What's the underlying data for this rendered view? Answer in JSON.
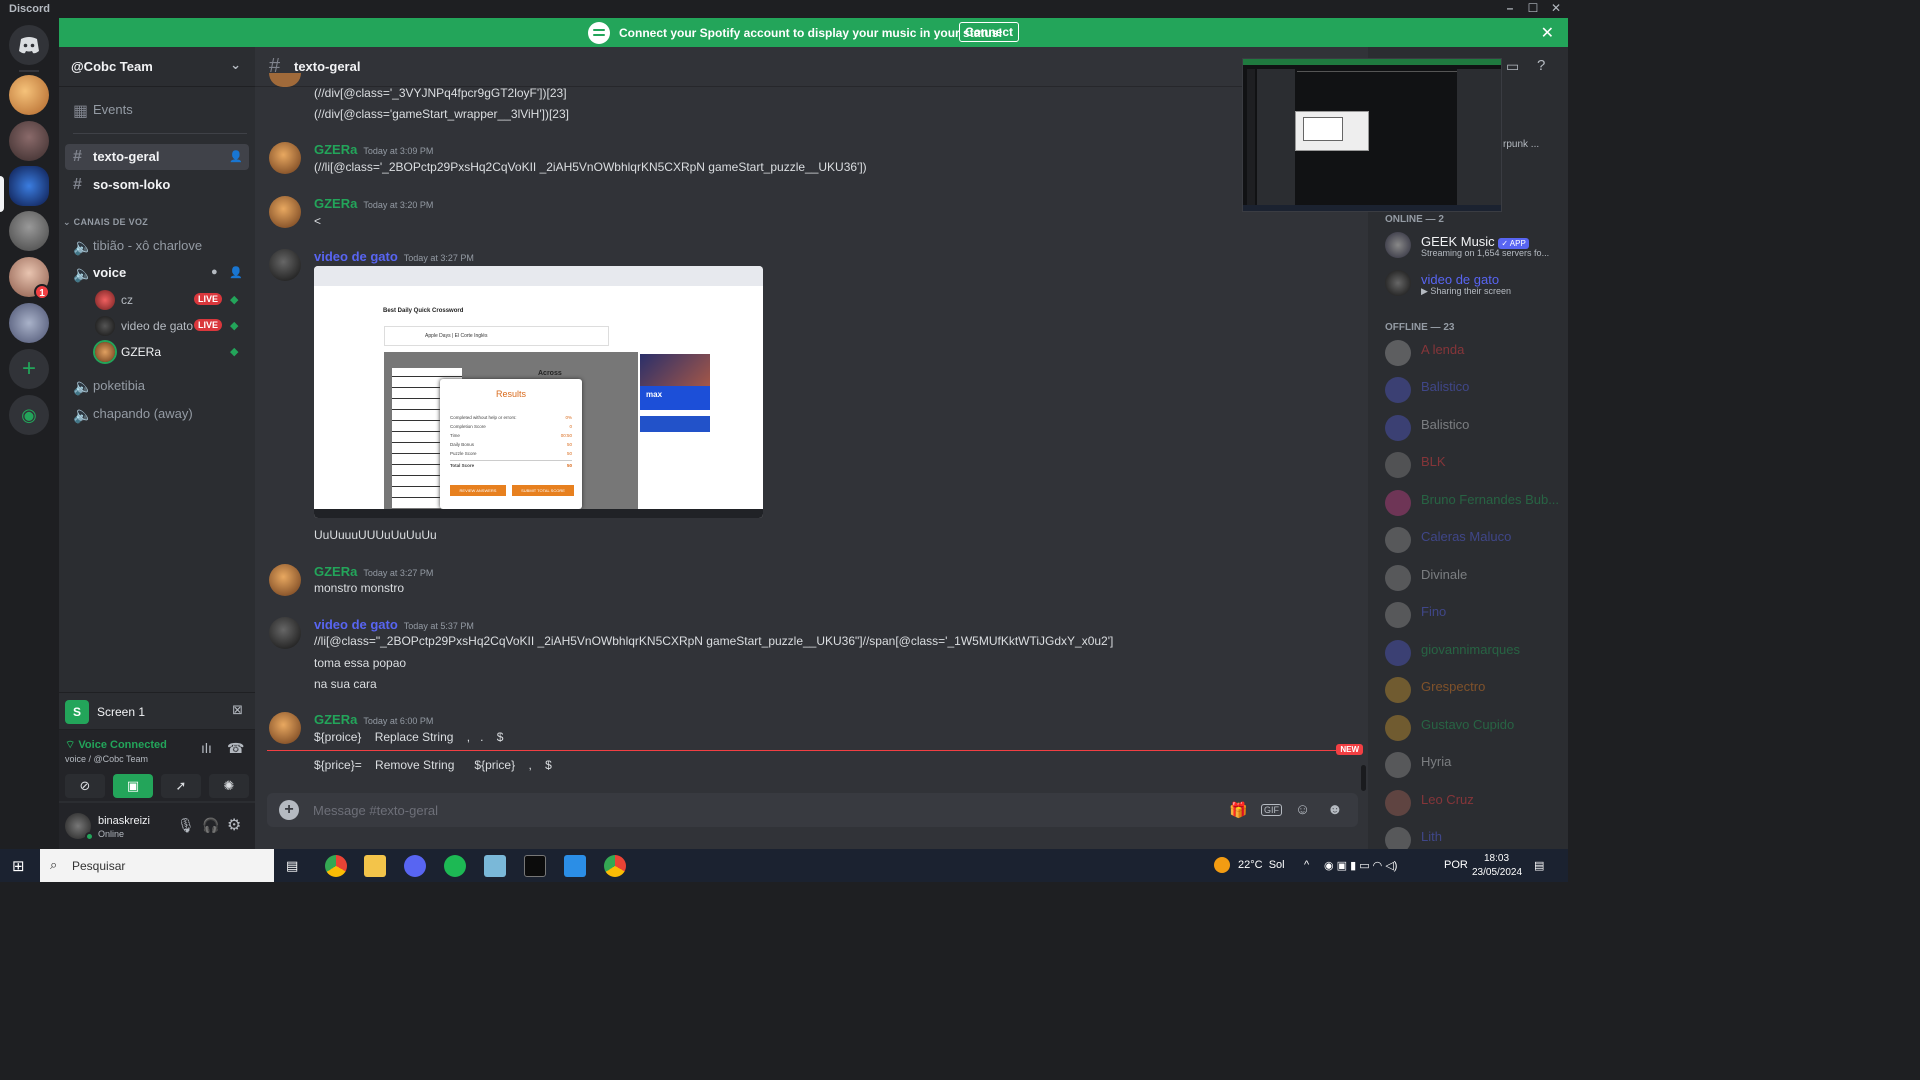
{
  "window": {
    "brand": "Discord"
  },
  "banner": {
    "text": "Connect your Spotify account to display your music in your status!",
    "button": "Connect"
  },
  "server": {
    "name": "@Cobc Team",
    "events_label": "Events",
    "channels": [
      {
        "name": "texto-geral"
      },
      {
        "name": "so-som-loko"
      }
    ],
    "voice_category": "CANAIS DE VOZ",
    "voice_channels": [
      {
        "name": "tibião - xô charlove"
      },
      {
        "name": "voice"
      },
      {
        "name": "poketibia"
      },
      {
        "name": "chapando (away)"
      }
    ],
    "voice_users": [
      {
        "name": "cz",
        "live": "LIVE"
      },
      {
        "name": "video de gato",
        "live": "LIVE"
      },
      {
        "name": "GZERa",
        "live": ""
      }
    ]
  },
  "guild_badge": "1",
  "screen_share": {
    "label": "Screen 1"
  },
  "voice_status": {
    "title": "Voice Connected",
    "subtitle": "voice / @Cobc Team"
  },
  "user": {
    "name": "binaskreizi",
    "status": "Online"
  },
  "channel": {
    "name": "texto-geral",
    "placeholder": "Message #texto-geral"
  },
  "messages": [
    {
      "lines": [
        "(//div[@class='_3VYJNPq4fpcr9gGT2loyF'])[23]",
        "(//div[@class='gameStart_wrapper__3lViH'])[23]"
      ]
    },
    {
      "author": "GZERa",
      "time": "Today at 3:09 PM",
      "lines": [
        "(//li[@class='_2BOPctp29PxsHq2CqVoKII _2iAH5VnOWbhlqrKN5CXRpN gameStart_puzzle__UKU36'])"
      ]
    },
    {
      "author": "GZERa",
      "time": "Today at 3:20 PM",
      "lines": [
        "<"
      ]
    },
    {
      "author": "video de gato",
      "time": "Today at 3:27 PM",
      "lines": [
        "UuUuuuUUUuUuUuUu"
      ]
    },
    {
      "author": "GZERa",
      "time": "Today at 3:27 PM",
      "lines": [
        "monstro monstro"
      ]
    },
    {
      "author": "video de gato",
      "time": "Today at 5:37 PM",
      "lines": [
        "//li[@class=\"_2BOPctp29PxsHq2CqVoKII _2iAH5VnOWbhlqrKN5CXRpN gameStart_puzzle__UKU36\"]//span[@class='_1W5MUfKktWTiJGdxY_x0u2']",
        "toma essa popao",
        "na sua cara"
      ]
    },
    {
      "author": "GZERa",
      "time": "Today at 6:00 PM",
      "lines": [
        "${proice}    Replace String    ,   .    $",
        "${price}=    Remove String      ${price}    ,    $"
      ]
    }
  ],
  "new_marker": "NEW",
  "embed": {
    "title": "Best Daily Quick Crossword",
    "results_title": "Results",
    "across": "Across",
    "ad_title": "Apple Days | El Corte Inglés",
    "max": "max",
    "buttons": [
      "REVIEW ANSWERS",
      "SUBMIT TOTAL SCORE"
    ],
    "rows": [
      {
        "label": "Completed without help or errors:",
        "value": "0%"
      },
      {
        "label": "Completion Score",
        "value": "0"
      },
      {
        "label": "Time",
        "value": "00:50"
      },
      {
        "label": "Daily Bonus",
        "value": "50"
      },
      {
        "label": "Puzzle Score",
        "value": "50"
      },
      {
        "label": "Total Score",
        "value": "50"
      }
    ]
  },
  "members": {
    "online_header": "ONLINE — 2",
    "online": [
      {
        "name": "GEEK Music",
        "tag": "✓ APP",
        "sub": "Streaming on 1,654 servers fo..."
      },
      {
        "name": "video de gato",
        "sub": "Sharing their screen"
      }
    ],
    "offline_header": "OFFLINE — 23",
    "offline": [
      "A lenda",
      "Balistico",
      "Balistico",
      "BLK",
      "Bruno Fernandes Bub...",
      "Caleras Maluco",
      "Divinale",
      "Fino",
      "giovannimarques",
      "Grespectro",
      "Gustavo Cupido",
      "Hyria",
      "Leo Cruz",
      "Lith"
    ]
  },
  "pip_label": "rpunk ...",
  "taskbar": {
    "search": "Pesquisar",
    "weather": "22°C  Sol",
    "lang": "POR",
    "time": "18:03",
    "date": "23/05/2024"
  }
}
